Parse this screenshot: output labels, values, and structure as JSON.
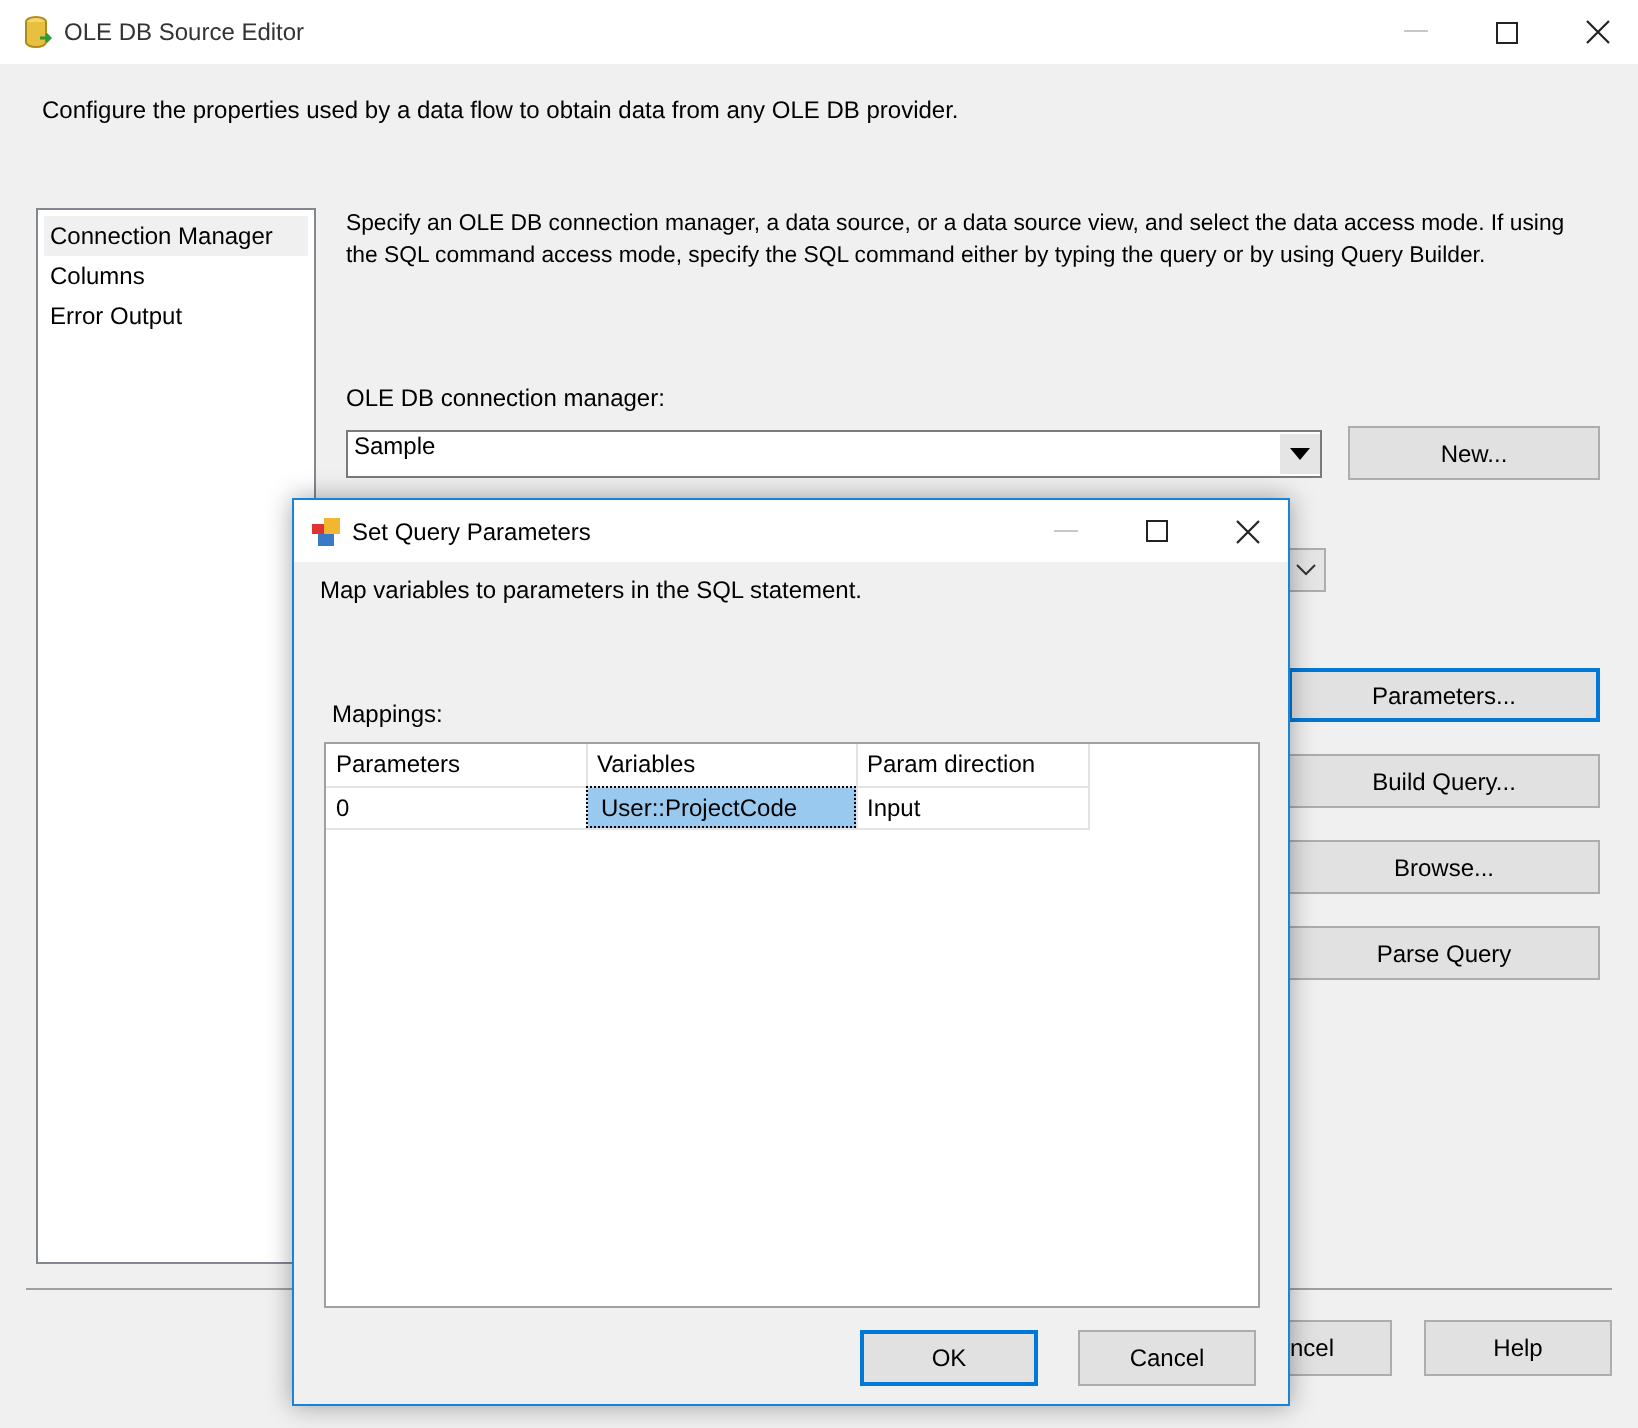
{
  "window": {
    "title": "OLE DB Source Editor",
    "description": "Configure the properties used by a data flow to obtain data from any OLE DB provider."
  },
  "sidebar": {
    "items": [
      {
        "label": "Connection Manager",
        "selected": true
      },
      {
        "label": "Columns",
        "selected": false
      },
      {
        "label": "Error Output",
        "selected": false
      }
    ]
  },
  "instructions": "Specify an OLE DB connection manager, a data source, or a data source view, and select the data access mode. If using the SQL command access mode, specify the SQL command either by typing the query or by using Query Builder.",
  "connection_manager": {
    "label": "OLE DB connection manager:",
    "value": "Sample",
    "button": "New..."
  },
  "side_buttons": [
    {
      "label": "Parameters...",
      "focused": true
    },
    {
      "label": "Build Query...",
      "focused": false
    },
    {
      "label": "Browse...",
      "focused": false
    },
    {
      "label": "Parse Query",
      "focused": false
    }
  ],
  "footer_buttons": [
    {
      "label": "ncel",
      "focused": false
    },
    {
      "label": "Help",
      "focused": false
    }
  ],
  "dialog": {
    "title": "Set Query Parameters",
    "description": "Map variables to parameters in the SQL statement.",
    "mappings_label": "Mappings:",
    "columns": [
      "Parameters",
      "Variables",
      "Param direction"
    ],
    "rows": [
      {
        "cells": [
          {
            "text": "0",
            "selected": false
          },
          {
            "text": "User::ProjectCode",
            "selected": true
          },
          {
            "text": "Input",
            "selected": false
          }
        ]
      }
    ],
    "buttons": [
      {
        "label": "OK",
        "focused": true
      },
      {
        "label": "Cancel",
        "focused": false
      }
    ]
  }
}
